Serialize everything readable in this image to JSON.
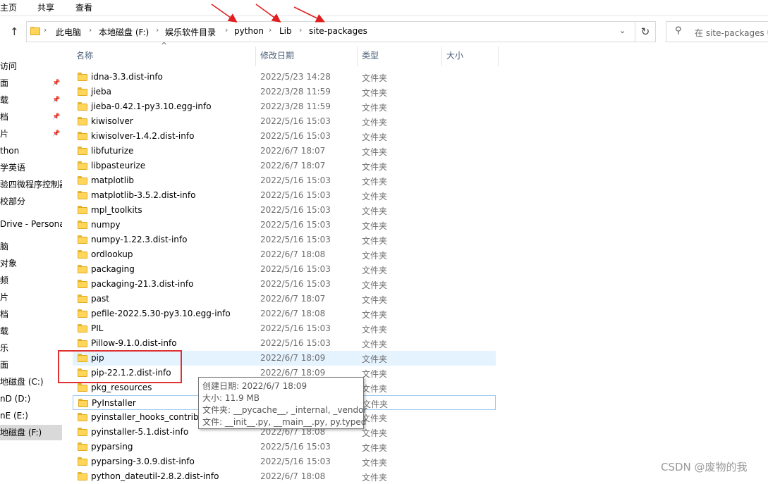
{
  "ribbon": {
    "tabs": [
      "主页",
      "共享",
      "查看"
    ]
  },
  "address": {
    "crumbs": [
      "此电脑",
      "本地磁盘 (F:)",
      "娱乐软件目录",
      "python",
      "Lib",
      "site-packages"
    ],
    "search_placeholder": "在 site-packages 中搜索"
  },
  "sidebar": {
    "items": [
      {
        "label": "访问",
        "pinned": false
      },
      {
        "label": "面",
        "pinned": true
      },
      {
        "label": "载",
        "pinned": true
      },
      {
        "label": "档",
        "pinned": true
      },
      {
        "label": "片",
        "pinned": true
      },
      {
        "label": "thon",
        "pinned": false
      },
      {
        "label": "学英语",
        "pinned": false
      },
      {
        "label": "验四微程序控制器",
        "pinned": false
      },
      {
        "label": "校部分",
        "pinned": false
      },
      {
        "label": "Drive - Persona",
        "pinned": false
      },
      {
        "label": "脑",
        "pinned": false
      },
      {
        "label": "对象",
        "pinned": false
      },
      {
        "label": "频",
        "pinned": false
      },
      {
        "label": "片",
        "pinned": false
      },
      {
        "label": "档",
        "pinned": false
      },
      {
        "label": "载",
        "pinned": false
      },
      {
        "label": "乐",
        "pinned": false
      },
      {
        "label": "面",
        "pinned": false
      },
      {
        "label": "地磁盘 (C:)",
        "pinned": false
      },
      {
        "label": "nD (D:)",
        "pinned": false
      },
      {
        "label": "nE (E:)",
        "pinned": false
      },
      {
        "label": "地磁盘 (F:)",
        "pinned": false,
        "selected": true
      }
    ]
  },
  "columns": {
    "name": "名称",
    "date": "修改日期",
    "type": "类型",
    "size": "大小"
  },
  "files": [
    {
      "name": "idna-3.3.dist-info",
      "date": "2022/5/23 14:28",
      "type": "文件夹"
    },
    {
      "name": "jieba",
      "date": "2022/3/28 11:59",
      "type": "文件夹"
    },
    {
      "name": "jieba-0.42.1-py3.10.egg-info",
      "date": "2022/3/28 11:59",
      "type": "文件夹"
    },
    {
      "name": "kiwisolver",
      "date": "2022/5/16 15:03",
      "type": "文件夹"
    },
    {
      "name": "kiwisolver-1.4.2.dist-info",
      "date": "2022/5/16 15:03",
      "type": "文件夹"
    },
    {
      "name": "libfuturize",
      "date": "2022/6/7 18:07",
      "type": "文件夹"
    },
    {
      "name": "libpasteurize",
      "date": "2022/6/7 18:07",
      "type": "文件夹"
    },
    {
      "name": "matplotlib",
      "date": "2022/5/16 15:03",
      "type": "文件夹"
    },
    {
      "name": "matplotlib-3.5.2.dist-info",
      "date": "2022/5/16 15:03",
      "type": "文件夹"
    },
    {
      "name": "mpl_toolkits",
      "date": "2022/5/16 15:03",
      "type": "文件夹"
    },
    {
      "name": "numpy",
      "date": "2022/5/16 15:03",
      "type": "文件夹"
    },
    {
      "name": "numpy-1.22.3.dist-info",
      "date": "2022/5/16 15:03",
      "type": "文件夹"
    },
    {
      "name": "ordlookup",
      "date": "2022/6/7 18:08",
      "type": "文件夹"
    },
    {
      "name": "packaging",
      "date": "2022/5/16 15:03",
      "type": "文件夹"
    },
    {
      "name": "packaging-21.3.dist-info",
      "date": "2022/5/16 15:03",
      "type": "文件夹"
    },
    {
      "name": "past",
      "date": "2022/6/7 18:07",
      "type": "文件夹"
    },
    {
      "name": "pefile-2022.5.30-py3.10.egg-info",
      "date": "2022/6/7 18:08",
      "type": "文件夹"
    },
    {
      "name": "PIL",
      "date": "2022/5/16 15:03",
      "type": "文件夹"
    },
    {
      "name": "Pillow-9.1.0.dist-info",
      "date": "2022/5/16 15:03",
      "type": "文件夹"
    },
    {
      "name": "pip",
      "date": "2022/6/7 18:09",
      "type": "文件夹",
      "state": "hover"
    },
    {
      "name": "pip-22.1.2.dist-info",
      "date": "2022/6/7 18:09",
      "type": "文件夹"
    },
    {
      "name": "pkg_resources",
      "date": "",
      "type": "文件夹"
    },
    {
      "name": "PyInstaller",
      "date": "",
      "type": "文件夹",
      "state": "focused"
    },
    {
      "name": "pyinstaller_hooks_contrib-",
      "date": "",
      "type": "文件夹"
    },
    {
      "name": "pyinstaller-5.1.dist-info",
      "date": "2022/6/7 18:08",
      "type": "文件夹"
    },
    {
      "name": "pyparsing",
      "date": "2022/5/16 15:03",
      "type": "文件夹"
    },
    {
      "name": "pyparsing-3.0.9.dist-info",
      "date": "2022/5/16 15:03",
      "type": "文件夹"
    },
    {
      "name": "python_dateutil-2.8.2.dist-info",
      "date": "2022/6/7 18:08",
      "type": "文件夹"
    }
  ],
  "tooltip": {
    "lines": [
      "创建日期: 2022/6/7 18:09",
      "大小: 11.9 MB",
      "文件夹: __pycache__, _internal, _vendor",
      "文件: __init__.py, __main__.py, py.typed"
    ]
  },
  "watermark": "CSDN @废物的我",
  "colors": {
    "annotation_red": "#e03131",
    "selection": "#e5f3ff",
    "folder": "#ffd55a"
  }
}
